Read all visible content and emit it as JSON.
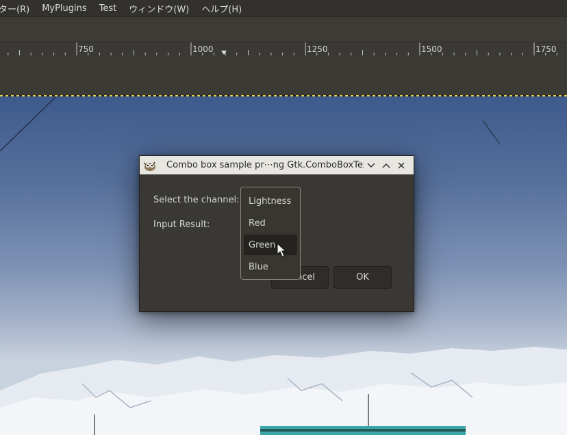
{
  "menubar": {
    "items": [
      {
        "label": "ター(R)"
      },
      {
        "label": "MyPlugins"
      },
      {
        "label": "Test"
      },
      {
        "label": "ウィンドウ(W)"
      },
      {
        "label": "ヘルプ(H)"
      }
    ]
  },
  "ruler": {
    "labels": [
      "750",
      "1000",
      "1250",
      "1500",
      "1750"
    ]
  },
  "dialog": {
    "title": "Combo box sample pr⋯ng Gtk.ComboBoxText",
    "icon": "gimp-icon",
    "controls": {
      "menu": "chevron-down-icon",
      "maximize": "chevron-up-icon",
      "close": "close-icon"
    },
    "channel_label": "Select the channel:",
    "result_label": "Input Result:",
    "cancel_label": "Cancel",
    "ok_label": "OK"
  },
  "dropdown": {
    "options": [
      {
        "label": "Lightness"
      },
      {
        "label": "Red"
      },
      {
        "label": "Green",
        "highlighted": true
      },
      {
        "label": "Blue"
      }
    ]
  },
  "colors": {
    "selection_marquee": "#e8d64a",
    "dialog_bg": "#393834",
    "titlebar_bg": "#e8e6e1"
  }
}
